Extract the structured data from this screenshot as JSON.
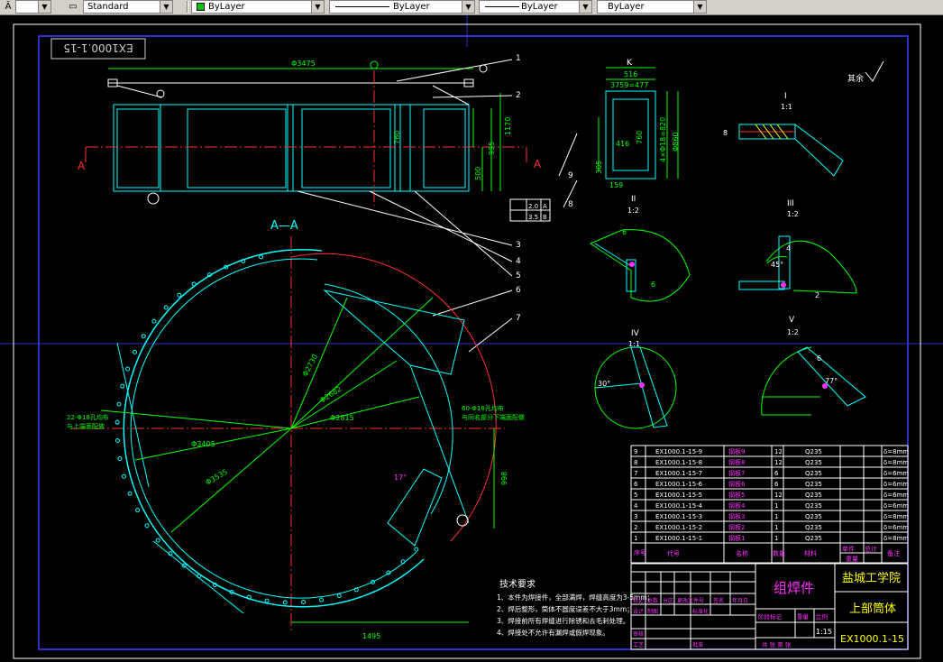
{
  "toolbar": {
    "text_style": "Standard",
    "color": "ByLayer",
    "color_swatch": "#00c000",
    "linetype": "ByLayer",
    "lineweight": "ByLayer",
    "plot_style": "ByLayer"
  },
  "drawing": {
    "drawing_no_rotated": "EX1000.1-15",
    "view_a_title": "A—A",
    "section_markers": {
      "a_left": "A",
      "a_right": "A"
    },
    "dims": {
      "d3475": "Φ3475",
      "d1170": "1170",
      "d995": "995",
      "d760": "760",
      "d500": "500",
      "d2730": "Φ2730",
      "d2682": "Φ2682",
      "d2815": "Φ2815",
      "d3405": "Φ3405",
      "d3535": "Φ3535",
      "d998": "998",
      "d1495": "1495",
      "a17": "17°",
      "k516": "516",
      "k3759": "3759=477",
      "k416": "416",
      "k760": "760",
      "k1820": "4×Φ18=820",
      "k860": "Φ860",
      "k159": "159",
      "k305": "305"
    },
    "leaders": [
      "1",
      "2",
      "3",
      "4",
      "5",
      "5",
      "6",
      "7",
      "8",
      "9"
    ],
    "view_k": "K",
    "roughness": "其余",
    "details": [
      {
        "roman": "I",
        "scale": "1:1"
      },
      {
        "roman": "II",
        "scale": "1:2"
      },
      {
        "roman": "III",
        "scale": "1:2"
      },
      {
        "roman": "IV",
        "scale": "1:1"
      },
      {
        "roman": "V",
        "scale": "1:2"
      }
    ],
    "detail_nums": {
      "six_a": "6",
      "six_b": "6",
      "six_c": "6",
      "angle45": "45°",
      "angle30": "30°",
      "angle77": "77°",
      "eight": "8",
      "four": "4",
      "two": "2"
    },
    "notes_title": "技术要求",
    "notes": [
      "1、本件为焊接件，全部满焊，焊缝高度为3-5mm；",
      "2、焊后整形，筒体不圆度误差不大于3mm；",
      "3、焊接前所有焊缝进行除锈和去毛刺处理。",
      "4、焊接处不允许有漏焊或假焊现象。"
    ],
    "gauge_note_1": "22-Φ18孔均布",
    "gauge_note_2": "与上端面配做",
    "flange_note_1": "60-Φ18孔均布",
    "flange_note_2": "与同名部分下端面配做",
    "fcf": {
      "a": "2.0",
      "b": "A",
      "c": "3.5",
      "d": "B"
    }
  },
  "bom": {
    "rows": [
      {
        "no": "9",
        "code": "EX1000.1-15-9",
        "name": "钢板9",
        "qty": "12",
        "mat": "Q235",
        "note": "δ=8mm"
      },
      {
        "no": "8",
        "code": "EX1000.1-15-8",
        "name": "钢板8",
        "qty": "12",
        "mat": "Q235",
        "note": "δ=8mm"
      },
      {
        "no": "7",
        "code": "EX1000.1-15-7",
        "name": "钢板7",
        "qty": "6",
        "mat": "Q235",
        "note": "δ=6mm"
      },
      {
        "no": "6",
        "code": "EX1000.1-15-6",
        "name": "钢板6",
        "qty": "6",
        "mat": "Q235",
        "note": "δ=6mm"
      },
      {
        "no": "5",
        "code": "EX1000.1-15-5",
        "name": "钢板5",
        "qty": "12",
        "mat": "Q235",
        "note": "δ=6mm"
      },
      {
        "no": "4",
        "code": "EX1000.1-15-4",
        "name": "钢板4",
        "qty": "1",
        "mat": "Q235",
        "note": "δ=6mm"
      },
      {
        "no": "3",
        "code": "EX1000.1-15-3",
        "name": "钢板3",
        "qty": "1",
        "mat": "Q235",
        "note": "δ=8mm"
      },
      {
        "no": "2",
        "code": "EX1000.1-15-2",
        "name": "钢板2",
        "qty": "1",
        "mat": "Q235",
        "note": "δ=6mm"
      },
      {
        "no": "1",
        "code": "EX1000.1-15-1",
        "name": "钢板1",
        "qty": "1",
        "mat": "Q235",
        "note": "δ=8mm"
      }
    ],
    "headers": {
      "no": "序号",
      "code": "代号",
      "name": "名称",
      "qty": "数量",
      "mat": "材料",
      "unit": "单件",
      "total": "总计",
      "weight": "重量",
      "remark": "备注"
    }
  },
  "title_block": {
    "part_type": "组焊件",
    "school": "盐城工学院",
    "part_name": "上部筒体",
    "drawing_no": "EX1000.1-15",
    "scale_value": "1:15",
    "labels": {
      "mark": "标记",
      "count": "处数",
      "zone": "分区",
      "change_doc": "更改文件号",
      "sign": "签名",
      "date": "年月日",
      "design": "设计",
      "draw": "制图",
      "standardize": "标准化",
      "review": "审核",
      "process": "工艺",
      "approve": "批准",
      "stage_mark": "阶段标记",
      "weight": "重量",
      "scale": "比例",
      "sheets": "共  张 第  张"
    }
  }
}
